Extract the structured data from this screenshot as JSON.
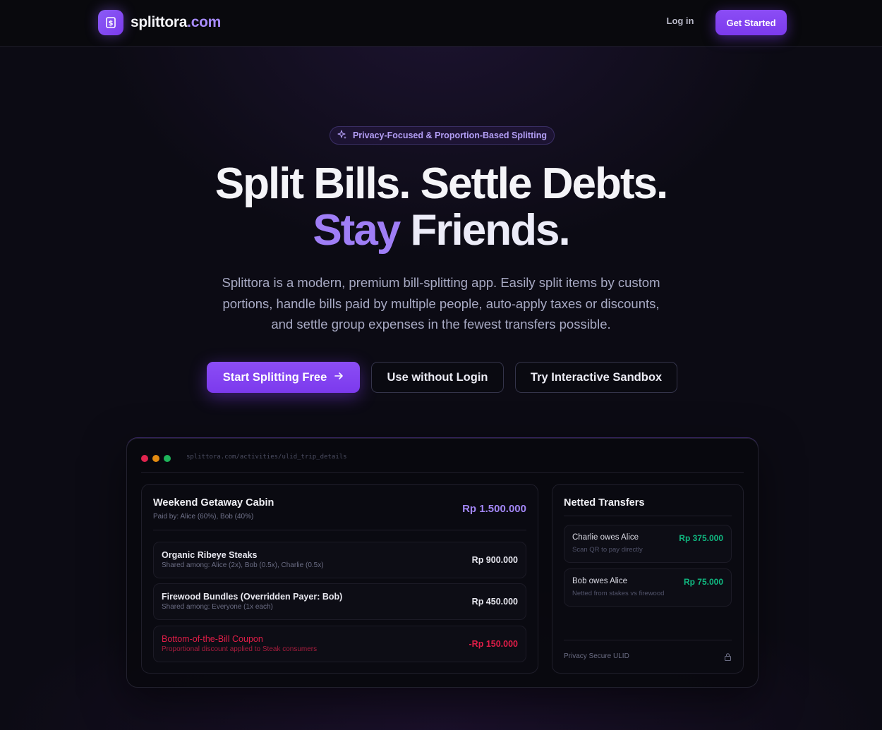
{
  "nav": {
    "logo_main": "splittora",
    "logo_tld": ".com",
    "logo_icon": "dollar-bill-icon",
    "login_label": "Log in",
    "get_started_label": "Get Started"
  },
  "hero": {
    "badge": "Privacy-Focused & Proportion-Based Splitting",
    "badge_icon": "sparkles-icon",
    "headline_line1": "Split Bills. Settle Debts.",
    "headline_line2_accent": "Stay",
    "headline_line2_rest": " Friends.",
    "subtitle": "Splittora is a modern, premium bill-splitting app. Easily split items by custom portions, handle bills paid by multiple people, auto-apply taxes or discounts, and settle group expenses in the fewest transfers possible.",
    "cta_primary": "Start Splitting Free",
    "cta_primary_icon": "arrow-right-icon",
    "cta_secondary": "Use without Login",
    "cta_tertiary": "Try Interactive Sandbox"
  },
  "preview": {
    "url": "splittora.com/activities/ulid_trip_details",
    "activity": {
      "title": "Weekend Getaway Cabin",
      "paid_by": "Paid by: Alice (60%), Bob (40%)",
      "total": "Rp 1.500.000",
      "items": [
        {
          "name": "Organic Ribeye Steaks",
          "shared": "Shared among: Alice (2x), Bob (0.5x), Charlie (0.5x)",
          "amount": "Rp 900.000"
        },
        {
          "name": "Firewood Bundles (Overridden Payer: Bob)",
          "shared": "Shared among: Everyone (1x each)",
          "amount": "Rp 450.000"
        },
        {
          "name": "Bottom-of-the-Bill Coupon",
          "shared": "Proportional discount applied to Steak consumers",
          "amount": "-Rp 150.000"
        }
      ]
    },
    "netted": {
      "title": "Netted Transfers",
      "transfers": [
        {
          "label": "Charlie owes Alice",
          "note": "Scan QR to pay directly",
          "amount": "Rp 375.000"
        },
        {
          "label": "Bob owes Alice",
          "note": "Netted from stakes vs firewood",
          "amount": "Rp 75.000"
        }
      ],
      "footer": "Privacy Secure ULID",
      "footer_icon": "lock-icon"
    }
  },
  "colors": {
    "accent": "#7c3aed",
    "accent_text": "#a78bfa",
    "positive": "#10b981",
    "negative": "#e11d48"
  }
}
